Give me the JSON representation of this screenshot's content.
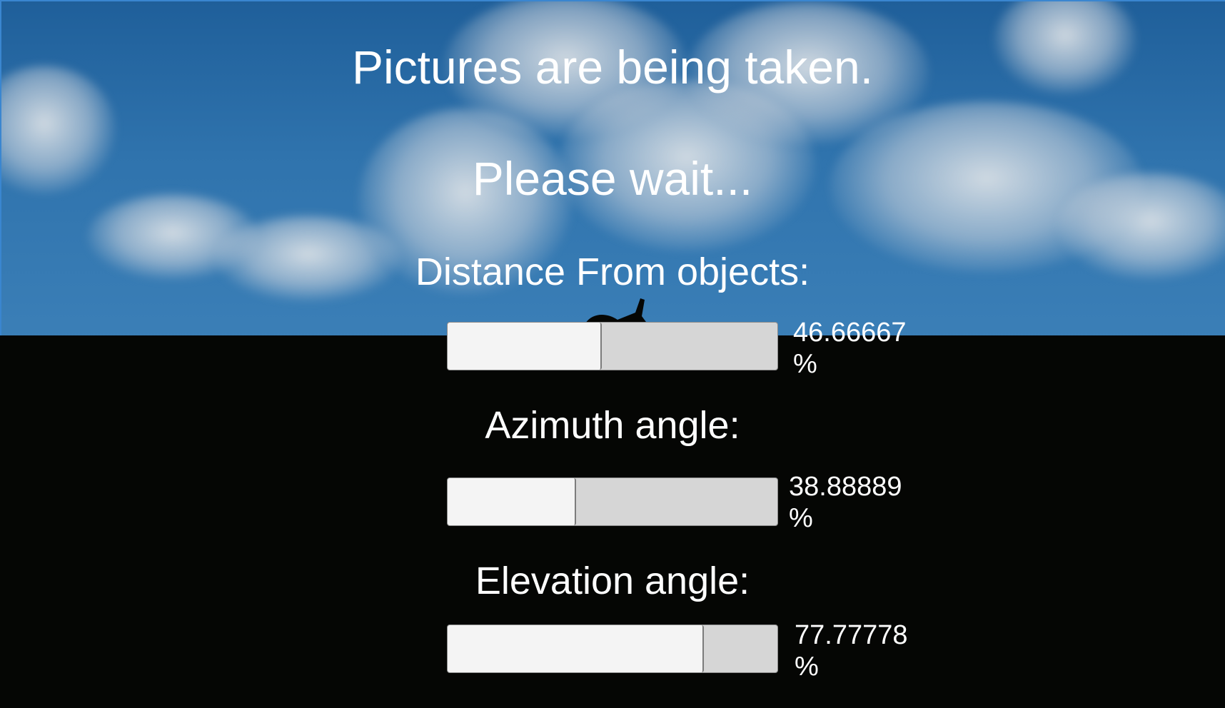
{
  "title_line_1": "Pictures are being taken.",
  "title_line_2": "Please wait...",
  "progress": [
    {
      "label": "Distance From objects:",
      "value": "46.66667",
      "unit": "%",
      "fraction": 0.4667
    },
    {
      "label": "Azimuth angle:",
      "value": "38.88889",
      "unit": "%",
      "fraction": 0.3889
    },
    {
      "label": "Elevation angle:",
      "value": "77.77778",
      "unit": "%",
      "fraction": 0.7778
    }
  ],
  "colors": {
    "sky": "#2f73ad",
    "ground": "#050604",
    "bar_track": "#d6d6d6",
    "bar_fill": "#f4f4f4",
    "text": "#ffffff"
  }
}
